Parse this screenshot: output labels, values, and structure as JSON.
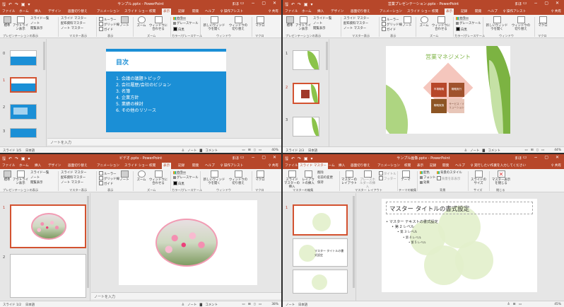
{
  "windows": [
    {
      "doc_title": "サンプル.pptx - PowerPoint",
      "user": "まほ",
      "tabs": [
        "ファイル",
        "ホーム",
        "挿入",
        "デザイン",
        "画面切り替え",
        "アニメーション",
        "スライド ショー",
        "校閲",
        "表示",
        "記録",
        "開発",
        "ヘルプ"
      ],
      "active_tab": "表示",
      "tell_me": "操作アシスト",
      "share": "共有",
      "ribbon": {
        "normal": "標準",
        "outline": "アウトライン表示",
        "sorter": "スライド一覧",
        "notes": "ノート",
        "reading": "閲覧表示",
        "slide_master": "スライド マスター",
        "handout_master": "配布資料マスター",
        "notes_master": "ノート マスター",
        "ruler": "ルーラー",
        "gridlines": "グリッド線",
        "guides": "ガイド",
        "notes_btn": "ノート",
        "zoom": "ズーム",
        "fit": "ウィンドウに合わせる",
        "color": "カラー",
        "grayscale": "グレースケール",
        "bw": "白黒",
        "new_window": "新しいウィンドウを開く",
        "switch_window": "ウィンドウの切り替え",
        "macro": "マクロ",
        "grp_presentation_views": "プレゼンテーションの表示",
        "grp_master_views": "マスター表示",
        "grp_show": "表示",
        "grp_zoom": "ズーム",
        "grp_color": "カラー/グレースケール",
        "grp_window": "ウィンドウ",
        "grp_macro": "マクロ"
      },
      "slide_numbers": [
        "0",
        "1",
        "2",
        "3"
      ],
      "slide_title": "目次",
      "slide_items": [
        "1. 会議の議題トピック",
        "2. 会社履歴/会社のビジョン",
        "3. 名簿",
        "4. 企業方針",
        "5. 業績の検討",
        "6. その他のリソース"
      ],
      "notes_placeholder": "ノートを入力",
      "status_slide": "スライド 1/5",
      "status_lang": "日本語",
      "status_right": "≙ ノート  ▇ コメント",
      "zoom": "40%"
    },
    {
      "doc_title": "営業プレゼンテーション.pptx - PowerPoint",
      "user": "まほ",
      "tabs": [
        "ファイル",
        "ホーム",
        "挿入",
        "デザイン",
        "画面切り替え",
        "アニメーション",
        "スライド ショー",
        "校閲",
        "表示",
        "記録",
        "開発",
        "ヘルプ"
      ],
      "active_tab": "表示",
      "tell_me": "操作アシスト",
      "share": "共有",
      "slide_numbers": [
        "1",
        "2",
        "3"
      ],
      "slide_title": "営業マネジメント",
      "blocks": [
        "市場戦略",
        "戦略実行",
        "戦略実施",
        "サービス・ソリューション"
      ],
      "status_slide": "スライド 2/3",
      "status_lang": "日本語",
      "status_right": "≙ ノート  ▇ コメント",
      "zoom": "44%"
    },
    {
      "doc_title": "ビデオ.pptx - PowerPoint",
      "user": "まほ",
      "tabs": [
        "ファイル",
        "ホーム",
        "挿入",
        "デザイン",
        "画面切り替え",
        "アニメーション",
        "スライド ショー",
        "校閲",
        "表示",
        "記録",
        "開発",
        "ヘルプ"
      ],
      "active_tab": "表示",
      "tell_me": "操作アシスト",
      "share": "共有",
      "slide_numbers": [
        "1",
        "2"
      ],
      "notes_placeholder": "ノートを入力",
      "status_slide": "スライド 1/2",
      "status_lang": "日本語",
      "status_right": "≙ ノート  ▇ コメント",
      "zoom": "38%"
    },
    {
      "doc_title": "サンプル画像.pptx - PowerPoint",
      "user": "まほ",
      "tabs": [
        "ファイル",
        "スライド マスター",
        "ホーム",
        "挿入",
        "画面切り替え",
        "アニメーション",
        "校閲",
        "表示",
        "記録",
        "開発",
        "ヘルプ"
      ],
      "active_tab": "スライド マスター",
      "tell_me": "実行したい作業を入力してください",
      "share": "共有",
      "ribbon": {
        "insert_master": "スライド マスターの挿入",
        "insert_layout": "レイアウトの挿入",
        "delete": "削除",
        "rename": "名前の変更",
        "preserve": "保持",
        "master_layout": "マスターのレイアウト",
        "insert_placeholder": "プレースホルダーの挿入",
        "title_chk": "タイトル",
        "footer_chk": "フッター",
        "themes": "テーマ",
        "colors": "配色",
        "fonts": "フォント",
        "effects": "効果",
        "bg_styles": "背景のスタイル",
        "hide_bg": "背景を非表示",
        "slide_size": "スライドのサイズ",
        "close_master": "マスター表示を閉じる",
        "grp_edit_master": "マスターの編集",
        "grp_master_layout": "マスター レイアウト",
        "grp_edit_theme": "テーマの編集",
        "grp_background": "背景",
        "grp_size": "サイズ",
        "grp_close": "閉じる"
      },
      "slide_numbers": [
        "1"
      ],
      "master_title": "マスター タイトルの書式設定",
      "master_levels": [
        "マスター テキストの書式設定",
        "第 2 レベル",
        "第 3 レベル",
        "第 4 レベル",
        "第 5 レベル"
      ],
      "thumb2_text": "マスター タイトルの書式設定",
      "status_slide": "ノート",
      "status_lang": "日本語",
      "status_right": "≙ ⊞ ▭",
      "zoom": "45%"
    }
  ]
}
